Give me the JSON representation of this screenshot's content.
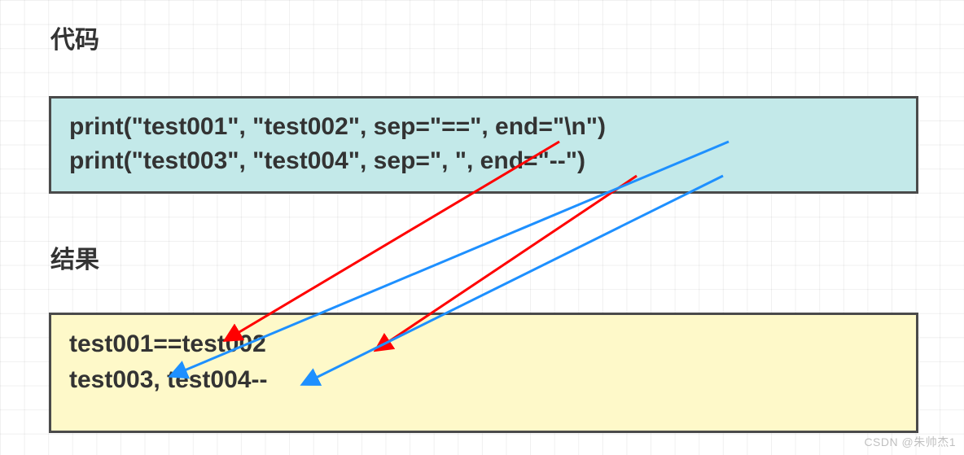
{
  "labels": {
    "code_heading": "代码",
    "result_heading": "结果"
  },
  "code": {
    "line1": "print(\"test001\", \"test002\", sep=\"==\", end=\"\\n\")",
    "line2": "print(\"test003\", \"test004\", sep=\", \", end=\"--\")"
  },
  "result": {
    "line1": "test001==test002",
    "line2": "test003, test004--"
  },
  "watermark": "CSDN @朱帅杰1",
  "arrows": {
    "red1": {
      "from": "code.line1.sep (==)",
      "to": "result.line1 between test001 and test002",
      "color": "#ff0000"
    },
    "red2": {
      "from": "code.line2.sep (, )",
      "to": "result.line2 between test003 and test004",
      "color": "#ff0000"
    },
    "blue1": {
      "from": "code.line1.end (\\n)",
      "to": "result.line2 start (new line)",
      "color": "#1e90ff"
    },
    "blue2": {
      "from": "code.line2.end (--)",
      "to": "result.line2 trailing --",
      "color": "#1e90ff"
    }
  }
}
